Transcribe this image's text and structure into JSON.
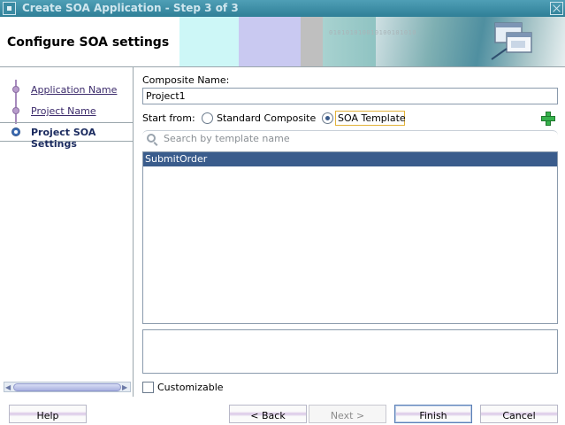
{
  "window": {
    "title": "Create SOA Application - Step 3 of 3",
    "system_menu_icon": "window-menu-icon",
    "close_icon": "close-icon"
  },
  "header": {
    "page_title": "Configure SOA settings",
    "binary_decoration": "010101010010100101010",
    "illustration_icon": "wizard-windows-icon",
    "band_colors": [
      "#cdf7f7",
      "#c9c9f1",
      "#b6b6e7",
      "#bfbfbf",
      "#8fc3c2",
      "#5a9aa3"
    ]
  },
  "nav": {
    "items": [
      {
        "label": "Application Name",
        "state": "completed"
      },
      {
        "label": "Project Name",
        "state": "completed"
      },
      {
        "label": "Project SOA Settings",
        "state": "current"
      }
    ]
  },
  "form": {
    "composite_name_label": "Composite Name:",
    "composite_name_value": "Project1",
    "start_from_label": "Start from:",
    "radio_standard_composite": "Standard Composite",
    "radio_soa_template": "SOA Template",
    "selected_start": "SOA Template",
    "search_placeholder": "Search by template name",
    "templates": [
      "SubmitOrder"
    ],
    "selected_template": "SubmitOrder",
    "customizable_label": "Customizable",
    "customizable_checked": false
  },
  "buttons": {
    "help": "Help",
    "back": "< Back",
    "next": "Next >",
    "finish": "Finish",
    "cancel": "Cancel"
  },
  "colors": {
    "titlebar": "#3a8aa2",
    "selection": "#3a5c8c",
    "focus_outline": "#e2b23a",
    "add_icon": "#37b24d"
  }
}
